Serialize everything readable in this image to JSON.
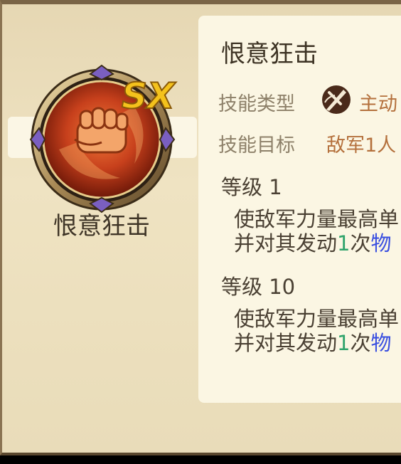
{
  "skill": {
    "name": "恨意狂击",
    "badge_label": "SX",
    "type_label": "技能类型",
    "type_value": "主动",
    "target_label": "技能目标",
    "target_value": "敌军1人"
  },
  "levels": [
    {
      "label": "等级 1",
      "line1": "使敌军力量最高单",
      "line2_prefix": "并对其发动",
      "line2_count": "1",
      "line2_mid": "次",
      "line2_type": "物"
    },
    {
      "label": "等级 10",
      "line1": "使敌军力量最高单",
      "line2_prefix": "并对其发动",
      "line2_count": "1",
      "line2_mid": "次",
      "line2_type": "物"
    }
  ],
  "icons": {
    "skill_badge": "fist-icon",
    "type": "crossed-swords-icon"
  },
  "colors": {
    "badge_text": "#f4c21c",
    "value_text": "#b4703c",
    "count_text": "#2fa36b",
    "damage_type_text": "#3a4fe0"
  }
}
